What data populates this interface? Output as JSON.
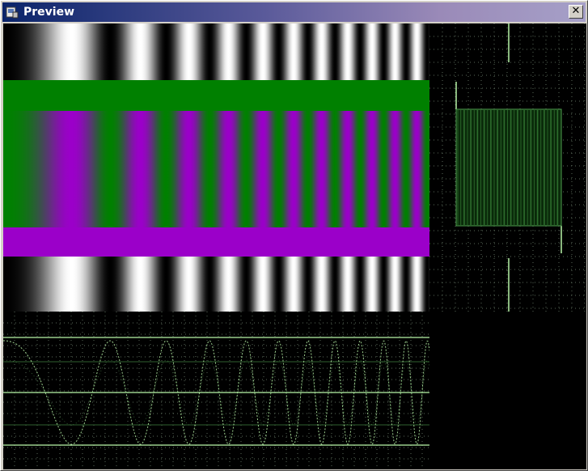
{
  "window": {
    "title": "Preview",
    "close_label": "✕",
    "icon": "preview-app-icon"
  },
  "colors": {
    "titlebar_start": "#0a246a",
    "titlebar_end": "#a6a0c8",
    "green": "#008000",
    "magenta": "#9b00c9",
    "scope_trace": "#b8f5a8",
    "grid_dots": "#5a6a5a"
  },
  "preview": {
    "description_bands": [
      "gray-sweep",
      "green-bar",
      "green-magenta-sweep",
      "magenta-bar",
      "gray-sweep"
    ]
  }
}
